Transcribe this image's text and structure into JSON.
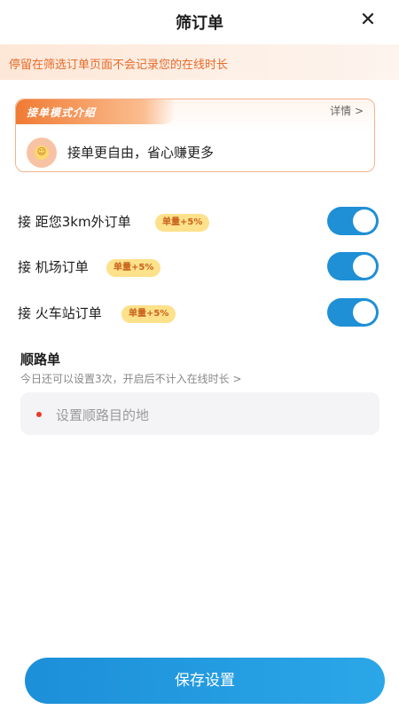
{
  "header": {
    "title": "筛订单",
    "close": "✕"
  },
  "notice": {
    "text": "停留在筛选订单页面不会记录您的在线时长"
  },
  "mode_card": {
    "tag": "接单模式介绍",
    "details": "详情 >",
    "slogan": "接单更自由，省心赚更多"
  },
  "options": [
    {
      "label": "接 距您3km外订单",
      "badge": "单量+5%",
      "on": true
    },
    {
      "label": "接 机场订单",
      "badge": "单量+5%",
      "on": true
    },
    {
      "label": "接 火车站订单",
      "badge": "单量+5%",
      "on": true
    }
  ],
  "route": {
    "title": "顺路单",
    "subtitle": "今日还可以设置3次，开启后不计入在线时长  >",
    "placeholder": "设置顺路目的地"
  },
  "footer": {
    "save_label": "保存设置"
  },
  "colors": {
    "accent": "#1f8fd6",
    "warning": "#e86a2a",
    "badge_bg": "#fde18b"
  }
}
